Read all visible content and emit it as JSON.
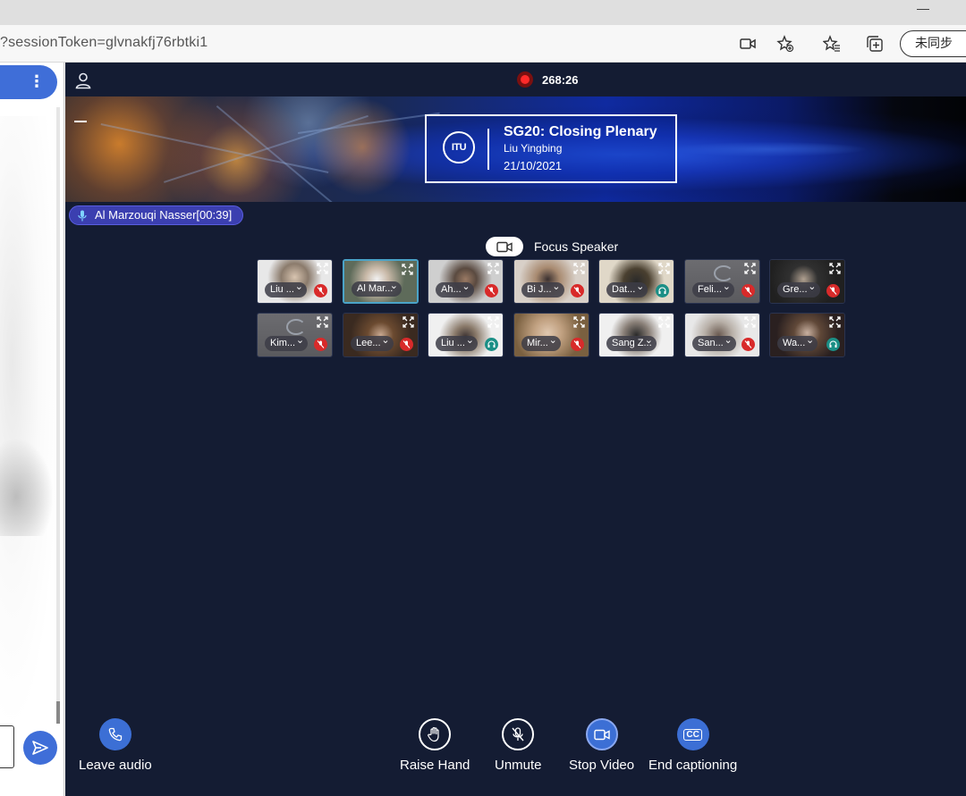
{
  "browser": {
    "url": "?sessionToken=glvnakfj76rbtki1",
    "sync_label": "未同步",
    "minimize_glyph": "—"
  },
  "left_panel": {
    "kebab_glyph": "⋮"
  },
  "meeting": {
    "timer": "268:26",
    "banner": {
      "title": "SG20: Closing Plenary",
      "host": "Liu Yingbing",
      "date": "21/10/2021",
      "logo_text": "ITU"
    },
    "active_speaker": "Al Marzouqi Nasser[00:39]",
    "focus_speaker_label": "Focus Speaker",
    "participants": [
      {
        "name": "Liu ...",
        "status": "muted",
        "video": true
      },
      {
        "name": "Al Mar...",
        "status": "none",
        "video": true,
        "active": true
      },
      {
        "name": "Ah...",
        "status": "muted",
        "video": true
      },
      {
        "name": "Bi J...",
        "status": "muted",
        "video": true
      },
      {
        "name": "Dat...",
        "status": "audio",
        "video": true
      },
      {
        "name": "Feli...",
        "status": "muted",
        "video": false
      },
      {
        "name": "Gre...",
        "status": "muted",
        "video": true
      },
      {
        "name": "Kim...",
        "status": "muted",
        "video": false
      },
      {
        "name": "Lee...",
        "status": "muted",
        "video": true
      },
      {
        "name": "Liu ...",
        "status": "audio",
        "video": true
      },
      {
        "name": "Mir...",
        "status": "muted",
        "video": true
      },
      {
        "name": "Sang Z...",
        "status": "none",
        "video": true
      },
      {
        "name": "San...",
        "status": "muted",
        "video": true
      },
      {
        "name": "Wa...",
        "status": "audio",
        "video": true
      }
    ],
    "controls": {
      "leave_audio": "Leave audio",
      "raise_hand": "Raise Hand",
      "unmute": "Unmute",
      "stop_video": "Stop Video",
      "end_captioning": "End captioning",
      "cc_glyph": "CC"
    }
  },
  "colors": {
    "meeting_bg": "#141c33",
    "accent_blue": "#3c6fd5",
    "muted_red": "#d82a2a",
    "audio_teal": "#1b8f86",
    "recording_red": "#ff2a2a"
  }
}
